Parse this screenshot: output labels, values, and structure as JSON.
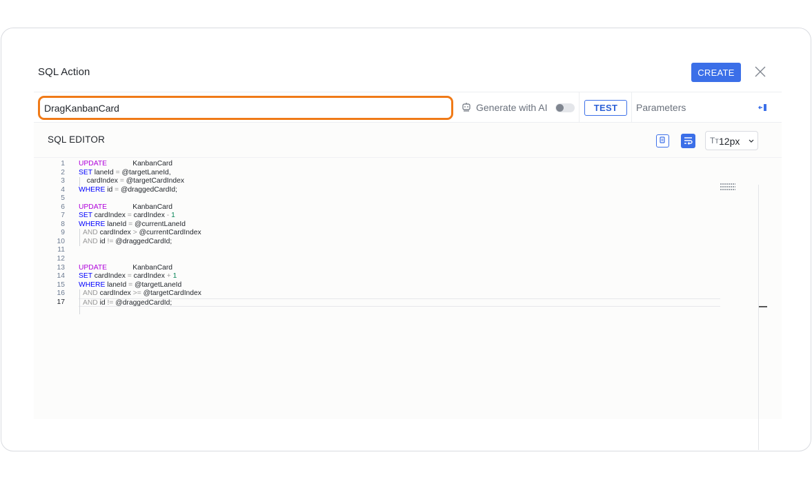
{
  "dialog": {
    "title": "SQL Action",
    "create_label": "CREATE"
  },
  "toolbar": {
    "name_value": "DragKanbanCard",
    "ai_label": "Generate with AI",
    "ai_toggle_on": false,
    "test_label": "TEST",
    "params_label": "Parameters"
  },
  "editor": {
    "title": "SQL EDITOR",
    "font_size_value": "12px",
    "font_size_icon": "Tт",
    "line_numbers": [
      "1",
      "2",
      "3",
      "4",
      "5",
      "6",
      "7",
      "8",
      "9",
      "10",
      "11",
      "12",
      "13",
      "14",
      "15",
      "16",
      "17"
    ],
    "active_line": "17"
  },
  "colors": {
    "accent": "#3b6fe8",
    "focus_border": "#f07a17",
    "keyword_update": "#af00db",
    "keyword_clause": "#0000ff",
    "number": "#098658"
  },
  "icons": [
    "robot-icon",
    "close-icon",
    "collapse-panel-icon",
    "copy-icon",
    "word-wrap-icon",
    "text-size-icon",
    "chevron-down-icon"
  ]
}
